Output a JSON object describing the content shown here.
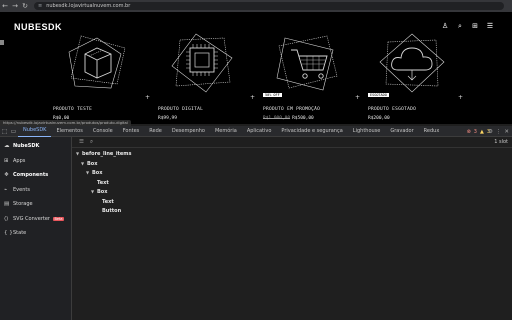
{
  "browser": {
    "url": "nubesdk.lojavirtualnuvem.com.br",
    "back_glyph": "←",
    "forward_glyph": "→",
    "reload_glyph": "↻",
    "tune_glyph": "≡"
  },
  "store": {
    "brand": "NUBESDK",
    "header_icons": [
      "user-icon",
      "search-icon",
      "cart-icon",
      "menu-icon"
    ],
    "header_glyphs": [
      "♙",
      "⌕",
      "⊞",
      "☰"
    ],
    "products": [
      {
        "name": "PRODUTO TESTE",
        "badge": "",
        "old_price": "",
        "price": "R$0,00"
      },
      {
        "name": "PRODUTO DIGITAL",
        "badge": "",
        "old_price": "",
        "price": "R$99,99"
      },
      {
        "name": "PRODUTO EM PROMOÇÃO",
        "badge": "50% OFF",
        "old_price": "R$1.000,00",
        "price": "R$500,00"
      },
      {
        "name": "PRODUTO ESGOTADO",
        "badge": "ESGOTADO",
        "old_price": "",
        "price": "R$200,00"
      }
    ],
    "plus_glyph": "+",
    "status_url": "https://nubesdk.lojavirtualnuvem.com.br/produtos/produto-digital"
  },
  "devtools": {
    "tabs": [
      "NubeSDK",
      "Elementos",
      "Console",
      "Fontes",
      "Rede",
      "Desempenho",
      "Memória",
      "Aplicativo",
      "Privacidade e segurança",
      "Lighthouse",
      "Gravador",
      "Redux"
    ],
    "active_tab": 0,
    "errors": "3",
    "warnings": "3",
    "error_glyph": "⊗",
    "warning_glyph": "▲",
    "settings_glyph": "⚙",
    "more_glyph": "⋮",
    "close_glyph": "✕",
    "inspect_glyph": "⬚",
    "device_glyph": "▭",
    "sidebar": [
      {
        "label": "NubeSDK",
        "glyph": "☁",
        "icon": "cloud-icon",
        "active": true,
        "beta": ""
      },
      {
        "label": "Apps",
        "glyph": "⊞",
        "icon": "apps-icon",
        "active": false,
        "beta": ""
      },
      {
        "label": "Components",
        "glyph": "❖",
        "icon": "components-icon",
        "active": true,
        "beta": ""
      },
      {
        "label": "Events",
        "glyph": "⌁",
        "icon": "events-icon",
        "active": false,
        "beta": ""
      },
      {
        "label": "Storage",
        "glyph": "▤",
        "icon": "storage-icon",
        "active": false,
        "beta": ""
      },
      {
        "label": "SVG Converter",
        "glyph": "⟨⟩",
        "icon": "code-icon",
        "active": false,
        "beta": "Beta"
      },
      {
        "label": "State",
        "glyph": "{ }",
        "icon": "braces-icon",
        "active": false,
        "beta": ""
      }
    ],
    "slot_selector_glyph": "☰",
    "search_glyph": "⌕",
    "slot_count": "1 slot",
    "tree": [
      {
        "label": "before_line_items",
        "depth": 0,
        "leaf": false
      },
      {
        "label": "Box",
        "depth": 1,
        "leaf": false
      },
      {
        "label": "Box",
        "depth": 2,
        "leaf": false
      },
      {
        "label": "Text",
        "depth": 3,
        "leaf": true
      },
      {
        "label": "Box",
        "depth": 3,
        "leaf": false
      },
      {
        "label": "Text",
        "depth": 4,
        "leaf": true
      },
      {
        "label": "Button",
        "depth": 4,
        "leaf": true
      }
    ],
    "caret_glyph": "▼"
  }
}
